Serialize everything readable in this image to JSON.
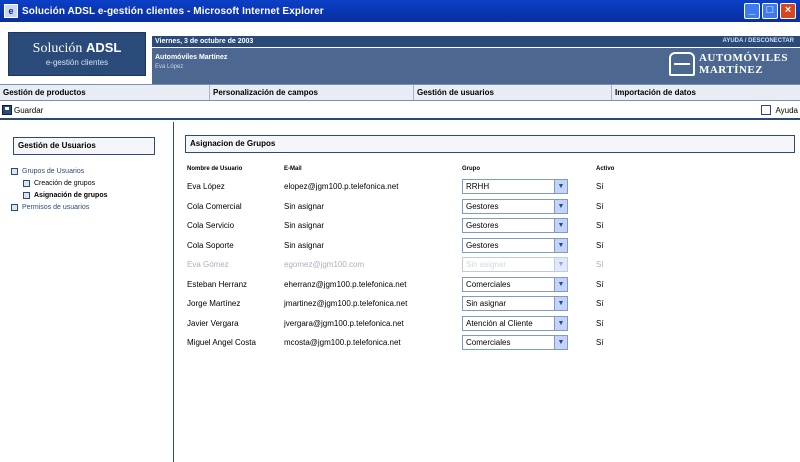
{
  "window": {
    "title": "Solución ADSL e-gestión clientes - Microsoft Internet Explorer",
    "minimize": "_",
    "maximize": "□",
    "close": "×"
  },
  "header": {
    "brand_main": "Solución",
    "brand_bold": "ADSL",
    "brand_sub": "e-gestión clientes",
    "date": "Viernes, 3 de octubre de 2003",
    "links": "AYUDA  /  DESCONECTAR",
    "company_user": "Automóviles Martínez",
    "user_name": "Eva López",
    "company_name_1": "AUTOMÓVILES",
    "company_name_2": "MARTÍNEZ"
  },
  "nav": {
    "items": [
      {
        "label": "Gestión de productos"
      },
      {
        "label": "Personalización de campos"
      },
      {
        "label": "Gestión de usuarios"
      },
      {
        "label": "Importación de datos"
      }
    ]
  },
  "toolbar": {
    "save_label": "Guardar",
    "help_label": "Ayuda"
  },
  "sidebar": {
    "heading": "Gestión de Usuarios",
    "items": [
      {
        "label": "Grupos de Usuarios"
      },
      {
        "label": "Creación de grupos"
      },
      {
        "label": "Asignación de grupos"
      },
      {
        "label": "Permisos de usuarios"
      }
    ]
  },
  "main": {
    "heading": "Asignacion de Grupos",
    "columns": {
      "name": "Nombre de Usuario",
      "email": "E-Mail",
      "group": "Grupo",
      "active": "Activo"
    },
    "rows": [
      {
        "name": "Eva López",
        "email": "elopez@jgm100.p.telefonica.net",
        "group": "RRHH",
        "active": "Sí"
      },
      {
        "name": "Cola Comercial",
        "email": "Sin asignar",
        "group": "Gestores",
        "active": "Sí"
      },
      {
        "name": "Cola Servicio",
        "email": "Sin asignar",
        "group": "Gestores",
        "active": "Sí"
      },
      {
        "name": "Cola Soporte",
        "email": "Sin asignar",
        "group": "Gestores",
        "active": "Sí"
      },
      {
        "name": "Eva Gómez",
        "email": "egomez@jgm100.com",
        "group": "Sin asignar",
        "active": "Sí"
      },
      {
        "name": "Esteban Herranz",
        "email": "eherranz@jgm100.p.telefonica.net",
        "group": "Comerciales",
        "active": "Sí"
      },
      {
        "name": "Jorge Martínez",
        "email": "jmartinez@jgm100.p.telefonica.net",
        "group": "Sin asignar",
        "active": "Sí"
      },
      {
        "name": "Javier Vergara",
        "email": "jvergara@jgm100.p.telefonica.net",
        "group": "Atención al Cliente",
        "active": "Sí"
      },
      {
        "name": "Miguel Angel Costa",
        "email": "mcosta@jgm100.p.telefonica.net",
        "group": "Comerciales",
        "active": "Sí"
      }
    ]
  }
}
